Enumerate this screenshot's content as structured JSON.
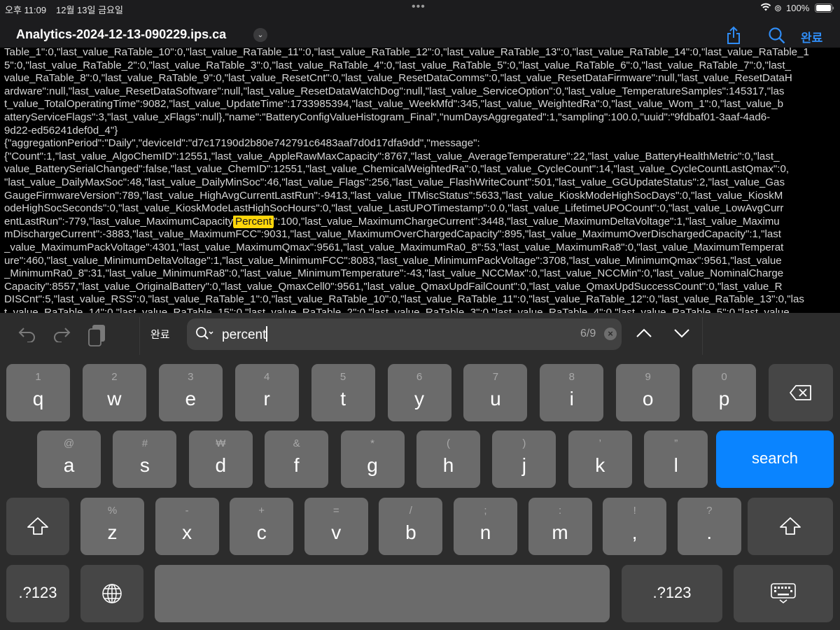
{
  "status_bar": {
    "time": "오후 11:09",
    "date": "12월 13일 금요일",
    "battery": "100%",
    "multitask_dots": "•••"
  },
  "header": {
    "title": "Analytics-2024-12-13-090229.ips.ca",
    "done_label": "완료",
    "icons": [
      "share-icon",
      "search-icon"
    ]
  },
  "document": {
    "lines": [
      "Table_1\":0,\"last_value_RaTable_10\":0,\"last_value_RaTable_11\":0,\"last_value_RaTable_12\":0,\"last_value_RaTable_13\":0,\"last_value_RaTable_14\":0,\"last_value_RaTable_1",
      "5\":0,\"last_value_RaTable_2\":0,\"last_value_RaTable_3\":0,\"last_value_RaTable_4\":0,\"last_value_RaTable_5\":0,\"last_value_RaTable_6\":0,\"last_value_RaTable_7\":0,\"last_",
      "value_RaTable_8\":0,\"last_value_RaTable_9\":0,\"last_value_ResetCnt\":0,\"last_value_ResetDataComms\":0,\"last_value_ResetDataFirmware\":null,\"last_value_ResetDataH",
      "ardware\":null,\"last_value_ResetDataSoftware\":null,\"last_value_ResetDataWatchDog\":null,\"last_value_ServiceOption\":0,\"last_value_TemperatureSamples\":145317,\"las",
      "t_value_TotalOperatingTime\":9082,\"last_value_UpdateTime\":1733985394,\"last_value_WeekMfd\":345,\"last_value_WeightedRa\":0,\"last_value_Wom_1\":0,\"last_value_b",
      "atteryServiceFlags\":3,\"last_value_xFlags\":null},\"name\":\"BatteryConfigValueHistogram_Final\",\"numDaysAggregated\":1,\"sampling\":100.0,\"uuid\":\"9fdbaf01-3aaf-4ad6-",
      "9d22-ed56241def0d_4\"}",
      "{\"aggregationPeriod\":\"Daily\",\"deviceId\":\"d7c17190d2b80e742791c6483aaf7d0d17dfa9dd\",\"message\":",
      "{\"Count\":1,\"last_value_AlgoChemID\":12551,\"last_value_AppleRawMaxCapacity\":8767,\"last_value_AverageTemperature\":22,\"last_value_BatteryHealthMetric\":0,\"last_",
      "value_BatterySerialChanged\":false,\"last_value_ChemID\":12551,\"last_value_ChemicalWeightedRa\":0,\"last_value_CycleCount\":14,\"last_value_CycleCountLastQmax\":0,",
      "\"last_value_DailyMaxSoc\":48,\"last_value_DailyMinSoc\":46,\"last_value_Flags\":256,\"last_value_FlashWriteCount\":501,\"last_value_GGUpdateStatus\":2,\"last_value_Gas",
      "GaugeFirmwareVersion\":789,\"last_value_HighAvgCurrentLastRun\":-9413,\"last_value_ITMiscStatus\":5633,\"last_value_KioskModeHighSocDays\":0,\"last_value_KioskM",
      "odeHighSocSeconds\":0,\"last_value_KioskModeLastHighSocHours\":0,\"last_value_LastUPOTimestamp\":0.0,\"last_value_LifetimeUPOCount\":0,\"last_value_LowAvgCurr",
      {
        "before": "entLastRun\":-779,\"last_value_MaximumCapacity",
        "match": "Percent",
        "after": "\":100,\"last_value_MaximumChargeCurrent\":3448,\"last_value_MaximumDeltaVoltage\":1,\"last_value_Maximu"
      },
      "mDischargeCurrent\":-3883,\"last_value_MaximumFCC\":9031,\"last_value_MaximumOverChargedCapacity\":895,\"last_value_MaximumOverDischargedCapacity\":1,\"last",
      "_value_MaximumPackVoltage\":4301,\"last_value_MaximumQmax\":9561,\"last_value_MaximumRa0_8\":53,\"last_value_MaximumRa8\":0,\"last_value_MaximumTemperat",
      "ure\":460,\"last_value_MinimumDeltaVoltage\":1,\"last_value_MinimumFCC\":8083,\"last_value_MinimumPackVoltage\":3708,\"last_value_MinimumQmax\":9561,\"last_value",
      "_MinimumRa0_8\":31,\"last_value_MinimumRa8\":0,\"last_value_MinimumTemperature\":-43,\"last_value_NCCMax\":0,\"last_value_NCCMin\":0,\"last_value_NominalCharge",
      "Capacity\":8557,\"last_value_OriginalBattery\":0,\"last_value_QmaxCell0\":9561,\"last_value_QmaxUpdFailCount\":0,\"last_value_QmaxUpdSuccessCount\":0,\"last_value_R",
      "DISCnt\":5,\"last_value_RSS\":0,\"last_value_RaTable_1\":0,\"last_value_RaTable_10\":0,\"last_value_RaTable_11\":0,\"last_value_RaTable_12\":0,\"last_value_RaTable_13\":0,\"las",
      "t_value_RaTable_14\":0,\"last_value_RaTable_15\":0,\"last_value_RaTable_2\":0,\"last_value_RaTable_3\":0,\"last_value_RaTable_4\":0,\"last_value_RaTable_5\":0,\"last_value"
    ]
  },
  "find_bar": {
    "done_label": "완료",
    "query": "percent",
    "match_count": "6/9",
    "clear_icon": "×"
  },
  "keyboard": {
    "rows": [
      [
        {
          "sub": "1",
          "main": "q"
        },
        {
          "sub": "2",
          "main": "w"
        },
        {
          "sub": "3",
          "main": "e"
        },
        {
          "sub": "4",
          "main": "r"
        },
        {
          "sub": "5",
          "main": "t"
        },
        {
          "sub": "6",
          "main": "y"
        },
        {
          "sub": "7",
          "main": "u"
        },
        {
          "sub": "8",
          "main": "i"
        },
        {
          "sub": "9",
          "main": "o"
        },
        {
          "sub": "0",
          "main": "p"
        }
      ],
      [
        {
          "sub": "@",
          "main": "a"
        },
        {
          "sub": "#",
          "main": "s"
        },
        {
          "sub": "₩",
          "main": "d"
        },
        {
          "sub": "&",
          "main": "f"
        },
        {
          "sub": "*",
          "main": "g"
        },
        {
          "sub": "(",
          "main": "h"
        },
        {
          "sub": ")",
          "main": "j"
        },
        {
          "sub": "’",
          "main": "k"
        },
        {
          "sub": "”",
          "main": "l"
        }
      ],
      [
        {
          "sub": "%",
          "main": "z"
        },
        {
          "sub": "-",
          "main": "x"
        },
        {
          "sub": "+",
          "main": "c"
        },
        {
          "sub": "=",
          "main": "v"
        },
        {
          "sub": "/",
          "main": "b"
        },
        {
          "sub": ";",
          "main": "n"
        },
        {
          "sub": ":",
          "main": "m"
        },
        {
          "sub": "!",
          "main": ","
        },
        {
          "sub": "?",
          "main": "."
        }
      ]
    ],
    "search_label": "search",
    "numbers_label": ".?123",
    "accent": "#0a84ff"
  }
}
